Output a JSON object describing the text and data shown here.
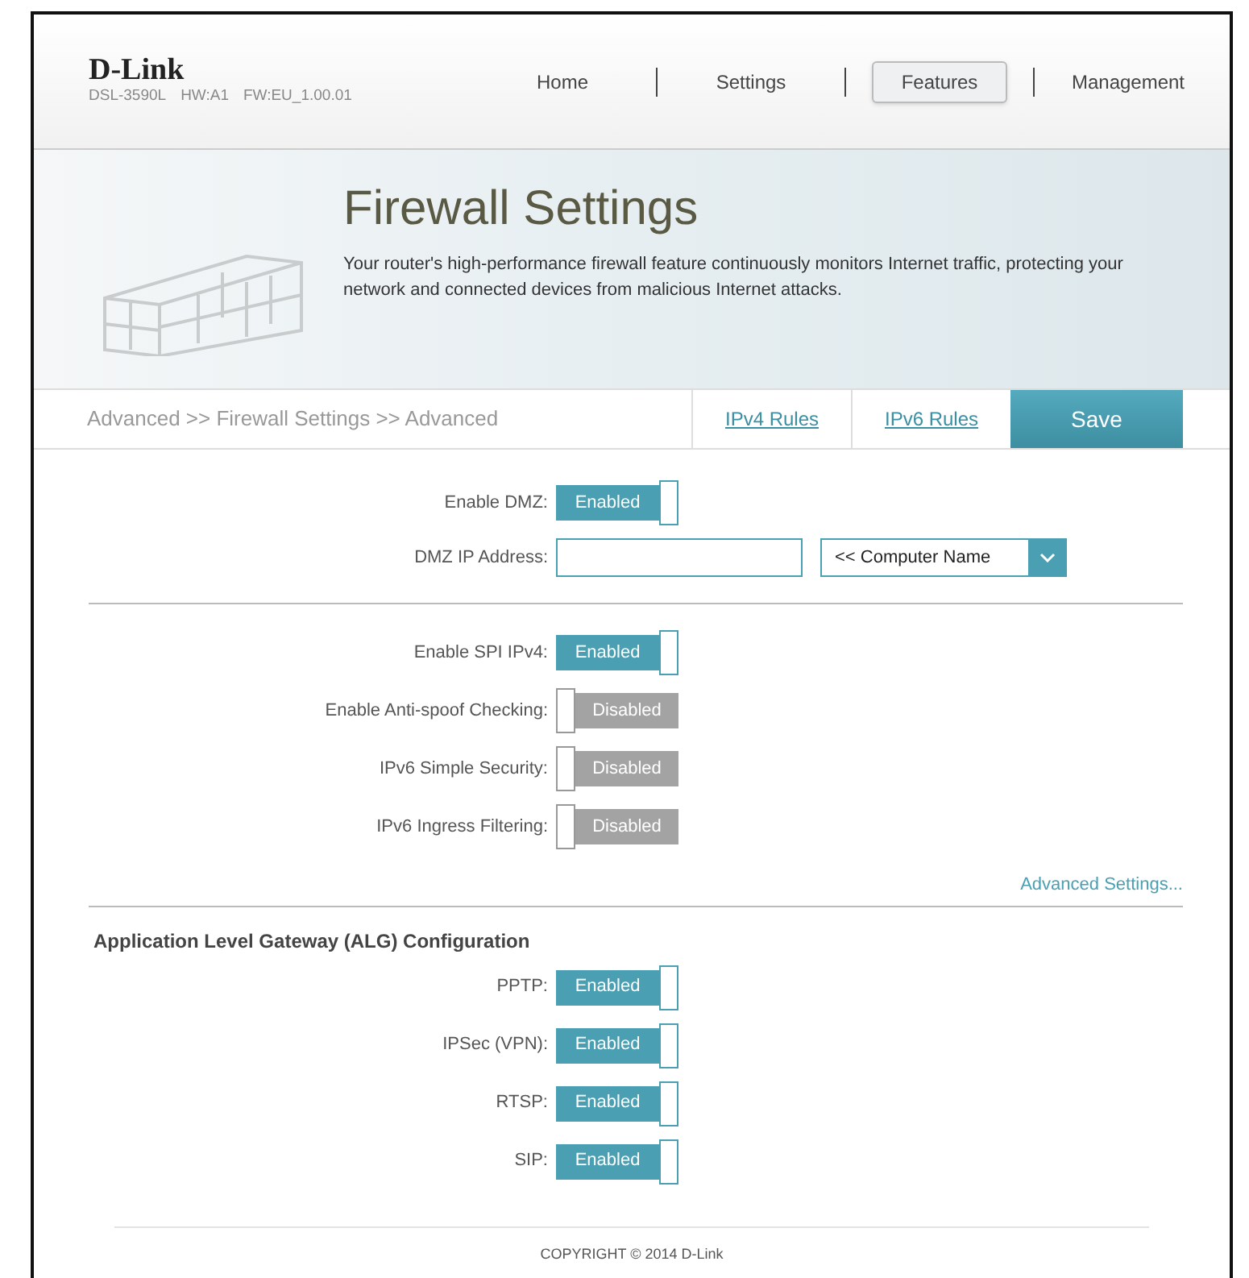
{
  "header": {
    "logo": "D-Link",
    "model": "DSL-3590L",
    "hardware": "HW:A1",
    "firmware": "FW:EU_1.00.01",
    "nav": [
      {
        "label": "Home",
        "selected": false
      },
      {
        "label": "Settings",
        "selected": false
      },
      {
        "label": "Features",
        "selected": true
      },
      {
        "label": "Management",
        "selected": false
      }
    ]
  },
  "banner": {
    "title": "Firewall Settings",
    "description": "Your router's high-performance firewall feature continuously monitors Internet traffic, protecting your network and connected devices from malicious Internet attacks."
  },
  "breadcrumb": "Advanced >> Firewall Settings >> Advanced",
  "links": [
    "IPv4 Rules",
    "IPv6 Rules"
  ],
  "save_button": "Save",
  "dmz": {
    "toggle": {
      "label": "Enable DMZ:",
      "state_text": "Enabled",
      "on": true
    },
    "ip_address": {
      "label": "DMZ IP Address:"
    },
    "computer_select": {
      "value": "<< Computer Name"
    }
  },
  "firewall_toggles": [
    {
      "label": "Enable SPI IPv4:",
      "state_text": "Enabled",
      "on": true
    },
    {
      "label": "Enable Anti-spoof Checking:",
      "state_text": "Disabled",
      "on": false
    },
    {
      "label": "IPv6 Simple Security:",
      "state_text": "Disabled",
      "on": false
    },
    {
      "label": "IPv6 Ingress Filtering:",
      "state_text": "Disabled",
      "on": false
    }
  ],
  "advanced_link": "Advanced Settings...",
  "alg": {
    "title": "Application Level Gateway (ALG) Configuration",
    "toggles": [
      {
        "label": "PPTP:",
        "state_text": "Enabled",
        "on": true
      },
      {
        "label": "IPSec (VPN):",
        "state_text": "Enabled",
        "on": true
      },
      {
        "label": "RTSP:",
        "state_text": "Enabled",
        "on": true
      },
      {
        "label": "SIP:",
        "state_text": "Enabled",
        "on": true
      }
    ]
  },
  "footer": "COPYRIGHT © 2014 D-Link"
}
